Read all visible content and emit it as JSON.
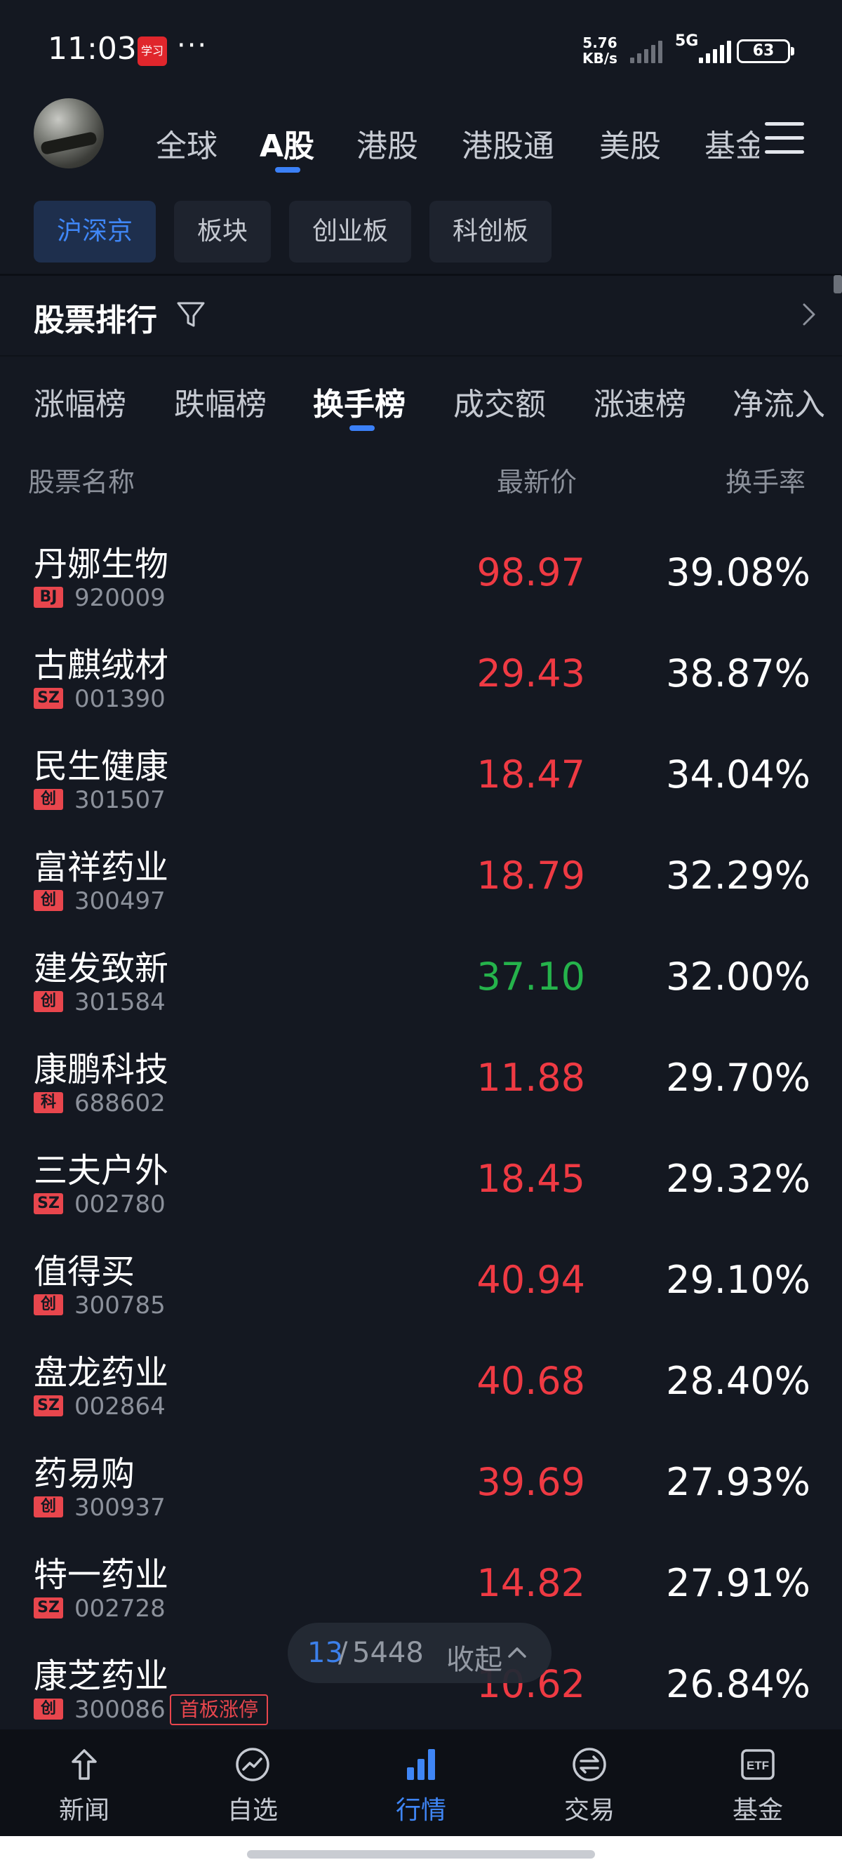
{
  "status_bar": {
    "time": "11:03",
    "app_icon_text": "学习",
    "more": "···",
    "net_speed_value": "5.76",
    "net_speed_unit": "KB/s",
    "network": "5G",
    "battery": "63"
  },
  "market_tabs": [
    "全球",
    "A股",
    "港股",
    "港股通",
    "美股",
    "基金"
  ],
  "market_tab_active": "A股",
  "sub_tabs": [
    "沪深京",
    "板块",
    "创业板",
    "科创板"
  ],
  "sub_tab_active": "沪深京",
  "ranking": {
    "title": "股票排行",
    "tabs": [
      "涨幅榜",
      "跌幅榜",
      "换手榜",
      "成交额",
      "涨速榜",
      "净流入"
    ],
    "active_tab": "换手榜"
  },
  "columns": {
    "name": "股票名称",
    "price": "最新价",
    "turnover": "换手率"
  },
  "stocks": [
    {
      "name": "丹娜生物",
      "badge": "BJ",
      "code": "920009",
      "price": "98.97",
      "turnover": "39.08%",
      "direction": "up"
    },
    {
      "name": "古麒绒材",
      "badge": "SZ",
      "code": "001390",
      "price": "29.43",
      "turnover": "38.87%",
      "direction": "up"
    },
    {
      "name": "民生健康",
      "badge": "创",
      "code": "301507",
      "price": "18.47",
      "turnover": "34.04%",
      "direction": "up"
    },
    {
      "name": "富祥药业",
      "badge": "创",
      "code": "300497",
      "price": "18.79",
      "turnover": "32.29%",
      "direction": "up"
    },
    {
      "name": "建发致新",
      "badge": "创",
      "code": "301584",
      "price": "37.10",
      "turnover": "32.00%",
      "direction": "down"
    },
    {
      "name": "康鹏科技",
      "badge": "科",
      "code": "688602",
      "price": "11.88",
      "turnover": "29.70%",
      "direction": "up"
    },
    {
      "name": "三夫户外",
      "badge": "SZ",
      "code": "002780",
      "price": "18.45",
      "turnover": "29.32%",
      "direction": "up"
    },
    {
      "name": "值得买",
      "badge": "创",
      "code": "300785",
      "price": "40.94",
      "turnover": "29.10%",
      "direction": "up"
    },
    {
      "name": "盘龙药业",
      "badge": "SZ",
      "code": "002864",
      "price": "40.68",
      "turnover": "28.40%",
      "direction": "up"
    },
    {
      "name": "药易购",
      "badge": "创",
      "code": "300937",
      "price": "39.69",
      "turnover": "27.93%",
      "direction": "up"
    },
    {
      "name": "特一药业",
      "badge": "SZ",
      "code": "002728",
      "price": "14.82",
      "turnover": "27.91%",
      "direction": "up"
    },
    {
      "name": "康芝药业",
      "badge": "创",
      "code": "300086",
      "price": "10.62",
      "turnover": "26.84%",
      "direction": "up",
      "tag": "首板涨停"
    }
  ],
  "pager": {
    "current": "13",
    "separator": "/",
    "total": "5448",
    "collapse_label": "收起"
  },
  "bottom_nav": [
    {
      "label": "新闻",
      "icon": "news-icon"
    },
    {
      "label": "自选",
      "icon": "watchlist-icon"
    },
    {
      "label": "行情",
      "icon": "market-icon"
    },
    {
      "label": "交易",
      "icon": "trade-icon"
    },
    {
      "label": "基金",
      "icon": "fund-etf-icon"
    }
  ],
  "bottom_nav_active": "行情",
  "colors": {
    "background": "#141821",
    "accent": "#3b80f7",
    "up": "#ef3a43",
    "down": "#25b34b"
  }
}
